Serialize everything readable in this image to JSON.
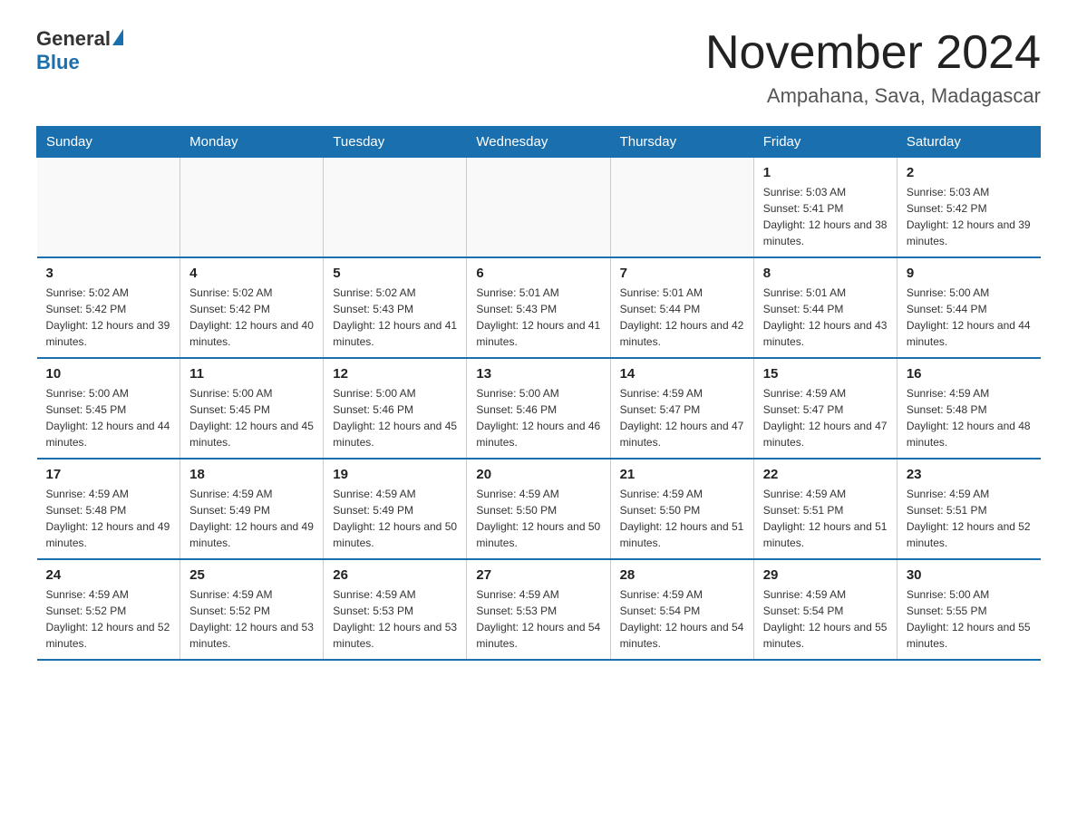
{
  "header": {
    "logo_general": "General",
    "logo_blue": "Blue",
    "month_title": "November 2024",
    "location": "Ampahana, Sava, Madagascar"
  },
  "weekdays": [
    "Sunday",
    "Monday",
    "Tuesday",
    "Wednesday",
    "Thursday",
    "Friday",
    "Saturday"
  ],
  "weeks": [
    [
      {
        "day": "",
        "sunrise": "",
        "sunset": "",
        "daylight": ""
      },
      {
        "day": "",
        "sunrise": "",
        "sunset": "",
        "daylight": ""
      },
      {
        "day": "",
        "sunrise": "",
        "sunset": "",
        "daylight": ""
      },
      {
        "day": "",
        "sunrise": "",
        "sunset": "",
        "daylight": ""
      },
      {
        "day": "",
        "sunrise": "",
        "sunset": "",
        "daylight": ""
      },
      {
        "day": "1",
        "sunrise": "Sunrise: 5:03 AM",
        "sunset": "Sunset: 5:41 PM",
        "daylight": "Daylight: 12 hours and 38 minutes."
      },
      {
        "day": "2",
        "sunrise": "Sunrise: 5:03 AM",
        "sunset": "Sunset: 5:42 PM",
        "daylight": "Daylight: 12 hours and 39 minutes."
      }
    ],
    [
      {
        "day": "3",
        "sunrise": "Sunrise: 5:02 AM",
        "sunset": "Sunset: 5:42 PM",
        "daylight": "Daylight: 12 hours and 39 minutes."
      },
      {
        "day": "4",
        "sunrise": "Sunrise: 5:02 AM",
        "sunset": "Sunset: 5:42 PM",
        "daylight": "Daylight: 12 hours and 40 minutes."
      },
      {
        "day": "5",
        "sunrise": "Sunrise: 5:02 AM",
        "sunset": "Sunset: 5:43 PM",
        "daylight": "Daylight: 12 hours and 41 minutes."
      },
      {
        "day": "6",
        "sunrise": "Sunrise: 5:01 AM",
        "sunset": "Sunset: 5:43 PM",
        "daylight": "Daylight: 12 hours and 41 minutes."
      },
      {
        "day": "7",
        "sunrise": "Sunrise: 5:01 AM",
        "sunset": "Sunset: 5:44 PM",
        "daylight": "Daylight: 12 hours and 42 minutes."
      },
      {
        "day": "8",
        "sunrise": "Sunrise: 5:01 AM",
        "sunset": "Sunset: 5:44 PM",
        "daylight": "Daylight: 12 hours and 43 minutes."
      },
      {
        "day": "9",
        "sunrise": "Sunrise: 5:00 AM",
        "sunset": "Sunset: 5:44 PM",
        "daylight": "Daylight: 12 hours and 44 minutes."
      }
    ],
    [
      {
        "day": "10",
        "sunrise": "Sunrise: 5:00 AM",
        "sunset": "Sunset: 5:45 PM",
        "daylight": "Daylight: 12 hours and 44 minutes."
      },
      {
        "day": "11",
        "sunrise": "Sunrise: 5:00 AM",
        "sunset": "Sunset: 5:45 PM",
        "daylight": "Daylight: 12 hours and 45 minutes."
      },
      {
        "day": "12",
        "sunrise": "Sunrise: 5:00 AM",
        "sunset": "Sunset: 5:46 PM",
        "daylight": "Daylight: 12 hours and 45 minutes."
      },
      {
        "day": "13",
        "sunrise": "Sunrise: 5:00 AM",
        "sunset": "Sunset: 5:46 PM",
        "daylight": "Daylight: 12 hours and 46 minutes."
      },
      {
        "day": "14",
        "sunrise": "Sunrise: 4:59 AM",
        "sunset": "Sunset: 5:47 PM",
        "daylight": "Daylight: 12 hours and 47 minutes."
      },
      {
        "day": "15",
        "sunrise": "Sunrise: 4:59 AM",
        "sunset": "Sunset: 5:47 PM",
        "daylight": "Daylight: 12 hours and 47 minutes."
      },
      {
        "day": "16",
        "sunrise": "Sunrise: 4:59 AM",
        "sunset": "Sunset: 5:48 PM",
        "daylight": "Daylight: 12 hours and 48 minutes."
      }
    ],
    [
      {
        "day": "17",
        "sunrise": "Sunrise: 4:59 AM",
        "sunset": "Sunset: 5:48 PM",
        "daylight": "Daylight: 12 hours and 49 minutes."
      },
      {
        "day": "18",
        "sunrise": "Sunrise: 4:59 AM",
        "sunset": "Sunset: 5:49 PM",
        "daylight": "Daylight: 12 hours and 49 minutes."
      },
      {
        "day": "19",
        "sunrise": "Sunrise: 4:59 AM",
        "sunset": "Sunset: 5:49 PM",
        "daylight": "Daylight: 12 hours and 50 minutes."
      },
      {
        "day": "20",
        "sunrise": "Sunrise: 4:59 AM",
        "sunset": "Sunset: 5:50 PM",
        "daylight": "Daylight: 12 hours and 50 minutes."
      },
      {
        "day": "21",
        "sunrise": "Sunrise: 4:59 AM",
        "sunset": "Sunset: 5:50 PM",
        "daylight": "Daylight: 12 hours and 51 minutes."
      },
      {
        "day": "22",
        "sunrise": "Sunrise: 4:59 AM",
        "sunset": "Sunset: 5:51 PM",
        "daylight": "Daylight: 12 hours and 51 minutes."
      },
      {
        "day": "23",
        "sunrise": "Sunrise: 4:59 AM",
        "sunset": "Sunset: 5:51 PM",
        "daylight": "Daylight: 12 hours and 52 minutes."
      }
    ],
    [
      {
        "day": "24",
        "sunrise": "Sunrise: 4:59 AM",
        "sunset": "Sunset: 5:52 PM",
        "daylight": "Daylight: 12 hours and 52 minutes."
      },
      {
        "day": "25",
        "sunrise": "Sunrise: 4:59 AM",
        "sunset": "Sunset: 5:52 PM",
        "daylight": "Daylight: 12 hours and 53 minutes."
      },
      {
        "day": "26",
        "sunrise": "Sunrise: 4:59 AM",
        "sunset": "Sunset: 5:53 PM",
        "daylight": "Daylight: 12 hours and 53 minutes."
      },
      {
        "day": "27",
        "sunrise": "Sunrise: 4:59 AM",
        "sunset": "Sunset: 5:53 PM",
        "daylight": "Daylight: 12 hours and 54 minutes."
      },
      {
        "day": "28",
        "sunrise": "Sunrise: 4:59 AM",
        "sunset": "Sunset: 5:54 PM",
        "daylight": "Daylight: 12 hours and 54 minutes."
      },
      {
        "day": "29",
        "sunrise": "Sunrise: 4:59 AM",
        "sunset": "Sunset: 5:54 PM",
        "daylight": "Daylight: 12 hours and 55 minutes."
      },
      {
        "day": "30",
        "sunrise": "Sunrise: 5:00 AM",
        "sunset": "Sunset: 5:55 PM",
        "daylight": "Daylight: 12 hours and 55 minutes."
      }
    ]
  ]
}
